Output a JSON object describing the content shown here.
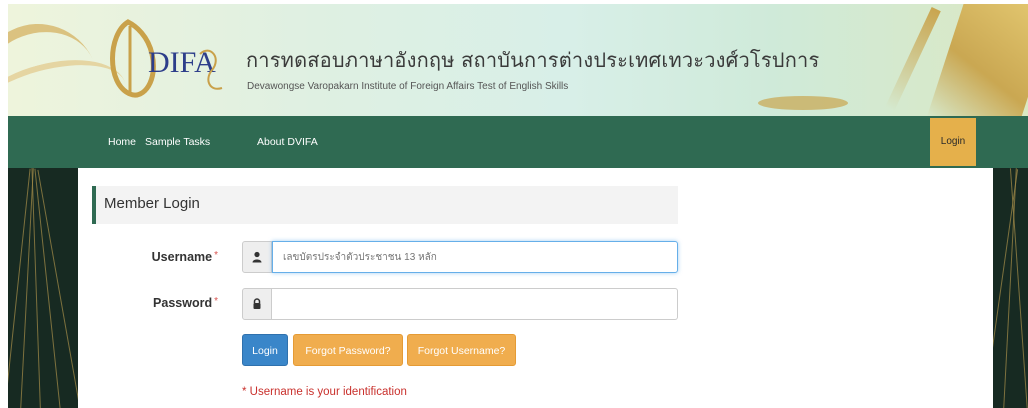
{
  "header": {
    "title_th": "การทดสอบภาษาอังกฤษ สถาบันการต่างประเทศเทวะวงศ์วโรปการ",
    "subtitle_en": "Devawongse Varopakarn Institute of Foreign Affairs Test of English Skills",
    "logo_text": "DIFA"
  },
  "nav": {
    "items": [
      {
        "label": "Home"
      },
      {
        "label": "Sample Tasks"
      },
      {
        "label": "About DVIFA"
      }
    ],
    "login_label": "Login"
  },
  "form": {
    "panel_title": "Member Login",
    "username": {
      "label": "Username",
      "required_mark": "*",
      "placeholder": "เลขบัตรประจำตัวประชาชน 13 หลัก",
      "value": ""
    },
    "password": {
      "label": "Password",
      "required_mark": "*",
      "value": ""
    },
    "buttons": {
      "login": "Login",
      "forgot_password": "Forgot Password?",
      "forgot_username": "Forgot Username?"
    },
    "help_text": "* Username is your identification"
  },
  "colors": {
    "nav_bg": "#2f6a52",
    "login_tab": "#e5b04b",
    "primary_button": "#3a86c9",
    "warning_button": "#f0ad4e",
    "required": "#c9302c"
  },
  "icons": {
    "username_addon": "user-icon",
    "password_addon": "lock-icon"
  }
}
